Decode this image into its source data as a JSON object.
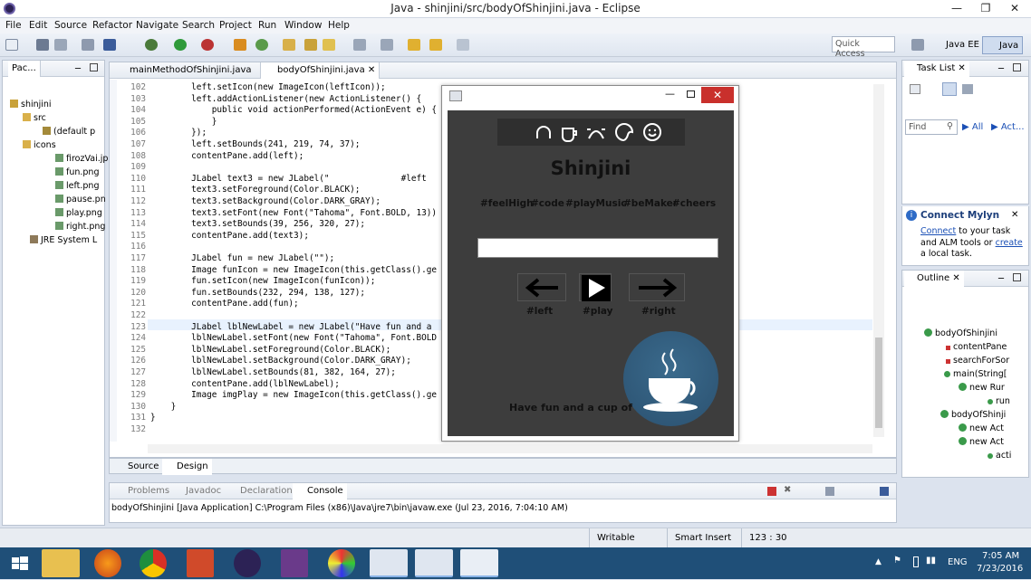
{
  "window": {
    "title": "Java - shinjini/src/bodyOfShinjini.java - Eclipse"
  },
  "menu": [
    "File",
    "Edit",
    "Source",
    "Refactor",
    "Navigate",
    "Search",
    "Project",
    "Run",
    "Window",
    "Help"
  ],
  "toolbar": {
    "quick_access": "Quick Access",
    "perspective_javaee": "Java EE",
    "perspective_java": "Java"
  },
  "package_explorer": {
    "tab": "Pac...",
    "tree": [
      "shinjini",
      "src",
      "(default p",
      "icons",
      "firozVai.jp",
      "fun.png",
      "left.png",
      "pause.pn",
      "play.png",
      "right.png",
      "JRE System L"
    ]
  },
  "editor": {
    "tabs": [
      "mainMethodOfShinjini.java",
      "bodyOfShinjini.java"
    ],
    "lines": [
      [
        "102",
        "        left.setIcon(new ImageIcon(leftIcon));"
      ],
      [
        "103",
        "        left.addActionListener(new ActionListener() {"
      ],
      [
        "104",
        "            public void actionPerformed(ActionEvent e) {"
      ],
      [
        "105",
        "            }"
      ],
      [
        "106",
        "        });"
      ],
      [
        "107",
        "        left.setBounds(241, 219, 74, 37);"
      ],
      [
        "108",
        "        contentPane.add(left);"
      ],
      [
        "109",
        ""
      ],
      [
        "110",
        "        JLabel text3 = new JLabel(\"              #left"
      ],
      [
        "111",
        "        text3.setForeground(Color.BLACK);"
      ],
      [
        "112",
        "        text3.setBackground(Color.DARK_GRAY);"
      ],
      [
        "113",
        "        text3.setFont(new Font(\"Tahoma\", Font.BOLD, 13))"
      ],
      [
        "114",
        "        text3.setBounds(39, 256, 320, 27);"
      ],
      [
        "115",
        "        contentPane.add(text3);"
      ],
      [
        "116",
        ""
      ],
      [
        "117",
        "        JLabel fun = new JLabel(\"\");"
      ],
      [
        "118",
        "        Image funIcon = new ImageIcon(this.getClass().ge"
      ],
      [
        "119",
        "        fun.setIcon(new ImageIcon(funIcon));"
      ],
      [
        "120",
        "        fun.setBounds(232, 294, 138, 127);"
      ],
      [
        "121",
        "        contentPane.add(fun);"
      ],
      [
        "122",
        ""
      ],
      [
        "123",
        "        JLabel lblNewLabel = new JLabel(\"Have fun and a"
      ],
      [
        "124",
        "        lblNewLabel.setFont(new Font(\"Tahoma\", Font.BOLD"
      ],
      [
        "125",
        "        lblNewLabel.setForeground(Color.BLACK);"
      ],
      [
        "126",
        "        lblNewLabel.setBackground(Color.DARK_GRAY);"
      ],
      [
        "127",
        "        lblNewLabel.setBounds(81, 382, 164, 27);"
      ],
      [
        "128",
        "        contentPane.add(lblNewLabel);"
      ],
      [
        "129",
        "        Image imgPlay = new ImageIcon(this.getClass().ge"
      ],
      [
        "130",
        "    }"
      ],
      [
        "131",
        "}"
      ],
      [
        "132",
        ""
      ]
    ],
    "bottom_tabs": [
      "Source",
      "Design"
    ]
  },
  "app_window": {
    "title": "Shinjini",
    "hashtags": [
      "#feelHigh",
      "#code",
      "#playMusic",
      "#beMaker",
      "#cheers"
    ],
    "buttons": [
      "#left",
      "#play",
      "#right"
    ],
    "tagline": "Have fun and a cup of"
  },
  "task_list": {
    "tab": "Task List",
    "find_placeholder": "Find",
    "all": "All",
    "activate": "Act..."
  },
  "mylyn": {
    "title": "Connect Mylyn",
    "link1": "Connect",
    "text1": " to your task and ALM tools or ",
    "link2": "create",
    "text2": " a local task."
  },
  "outline": {
    "tab": "Outline",
    "items": [
      "bodyOfShinjini",
      "contentPane",
      "searchForSor",
      "main(String[",
      "new Rur",
      "run",
      "bodyOfShinji",
      "new Act",
      "new Act",
      "acti"
    ]
  },
  "console": {
    "tabs": [
      "Problems",
      "Javadoc",
      "Declaration",
      "Console"
    ],
    "line": "bodyOfShinjini [Java Application] C:\\Program Files (x86)\\Java\\jre7\\bin\\javaw.exe (Jul 23, 2016, 7:04:10 AM)"
  },
  "status": {
    "writable": "Writable",
    "insert": "Smart Insert",
    "position": "123 : 30"
  },
  "taskbar": {
    "time": "7:05 AM",
    "date": "7/23/2016",
    "lang": "ENG"
  }
}
